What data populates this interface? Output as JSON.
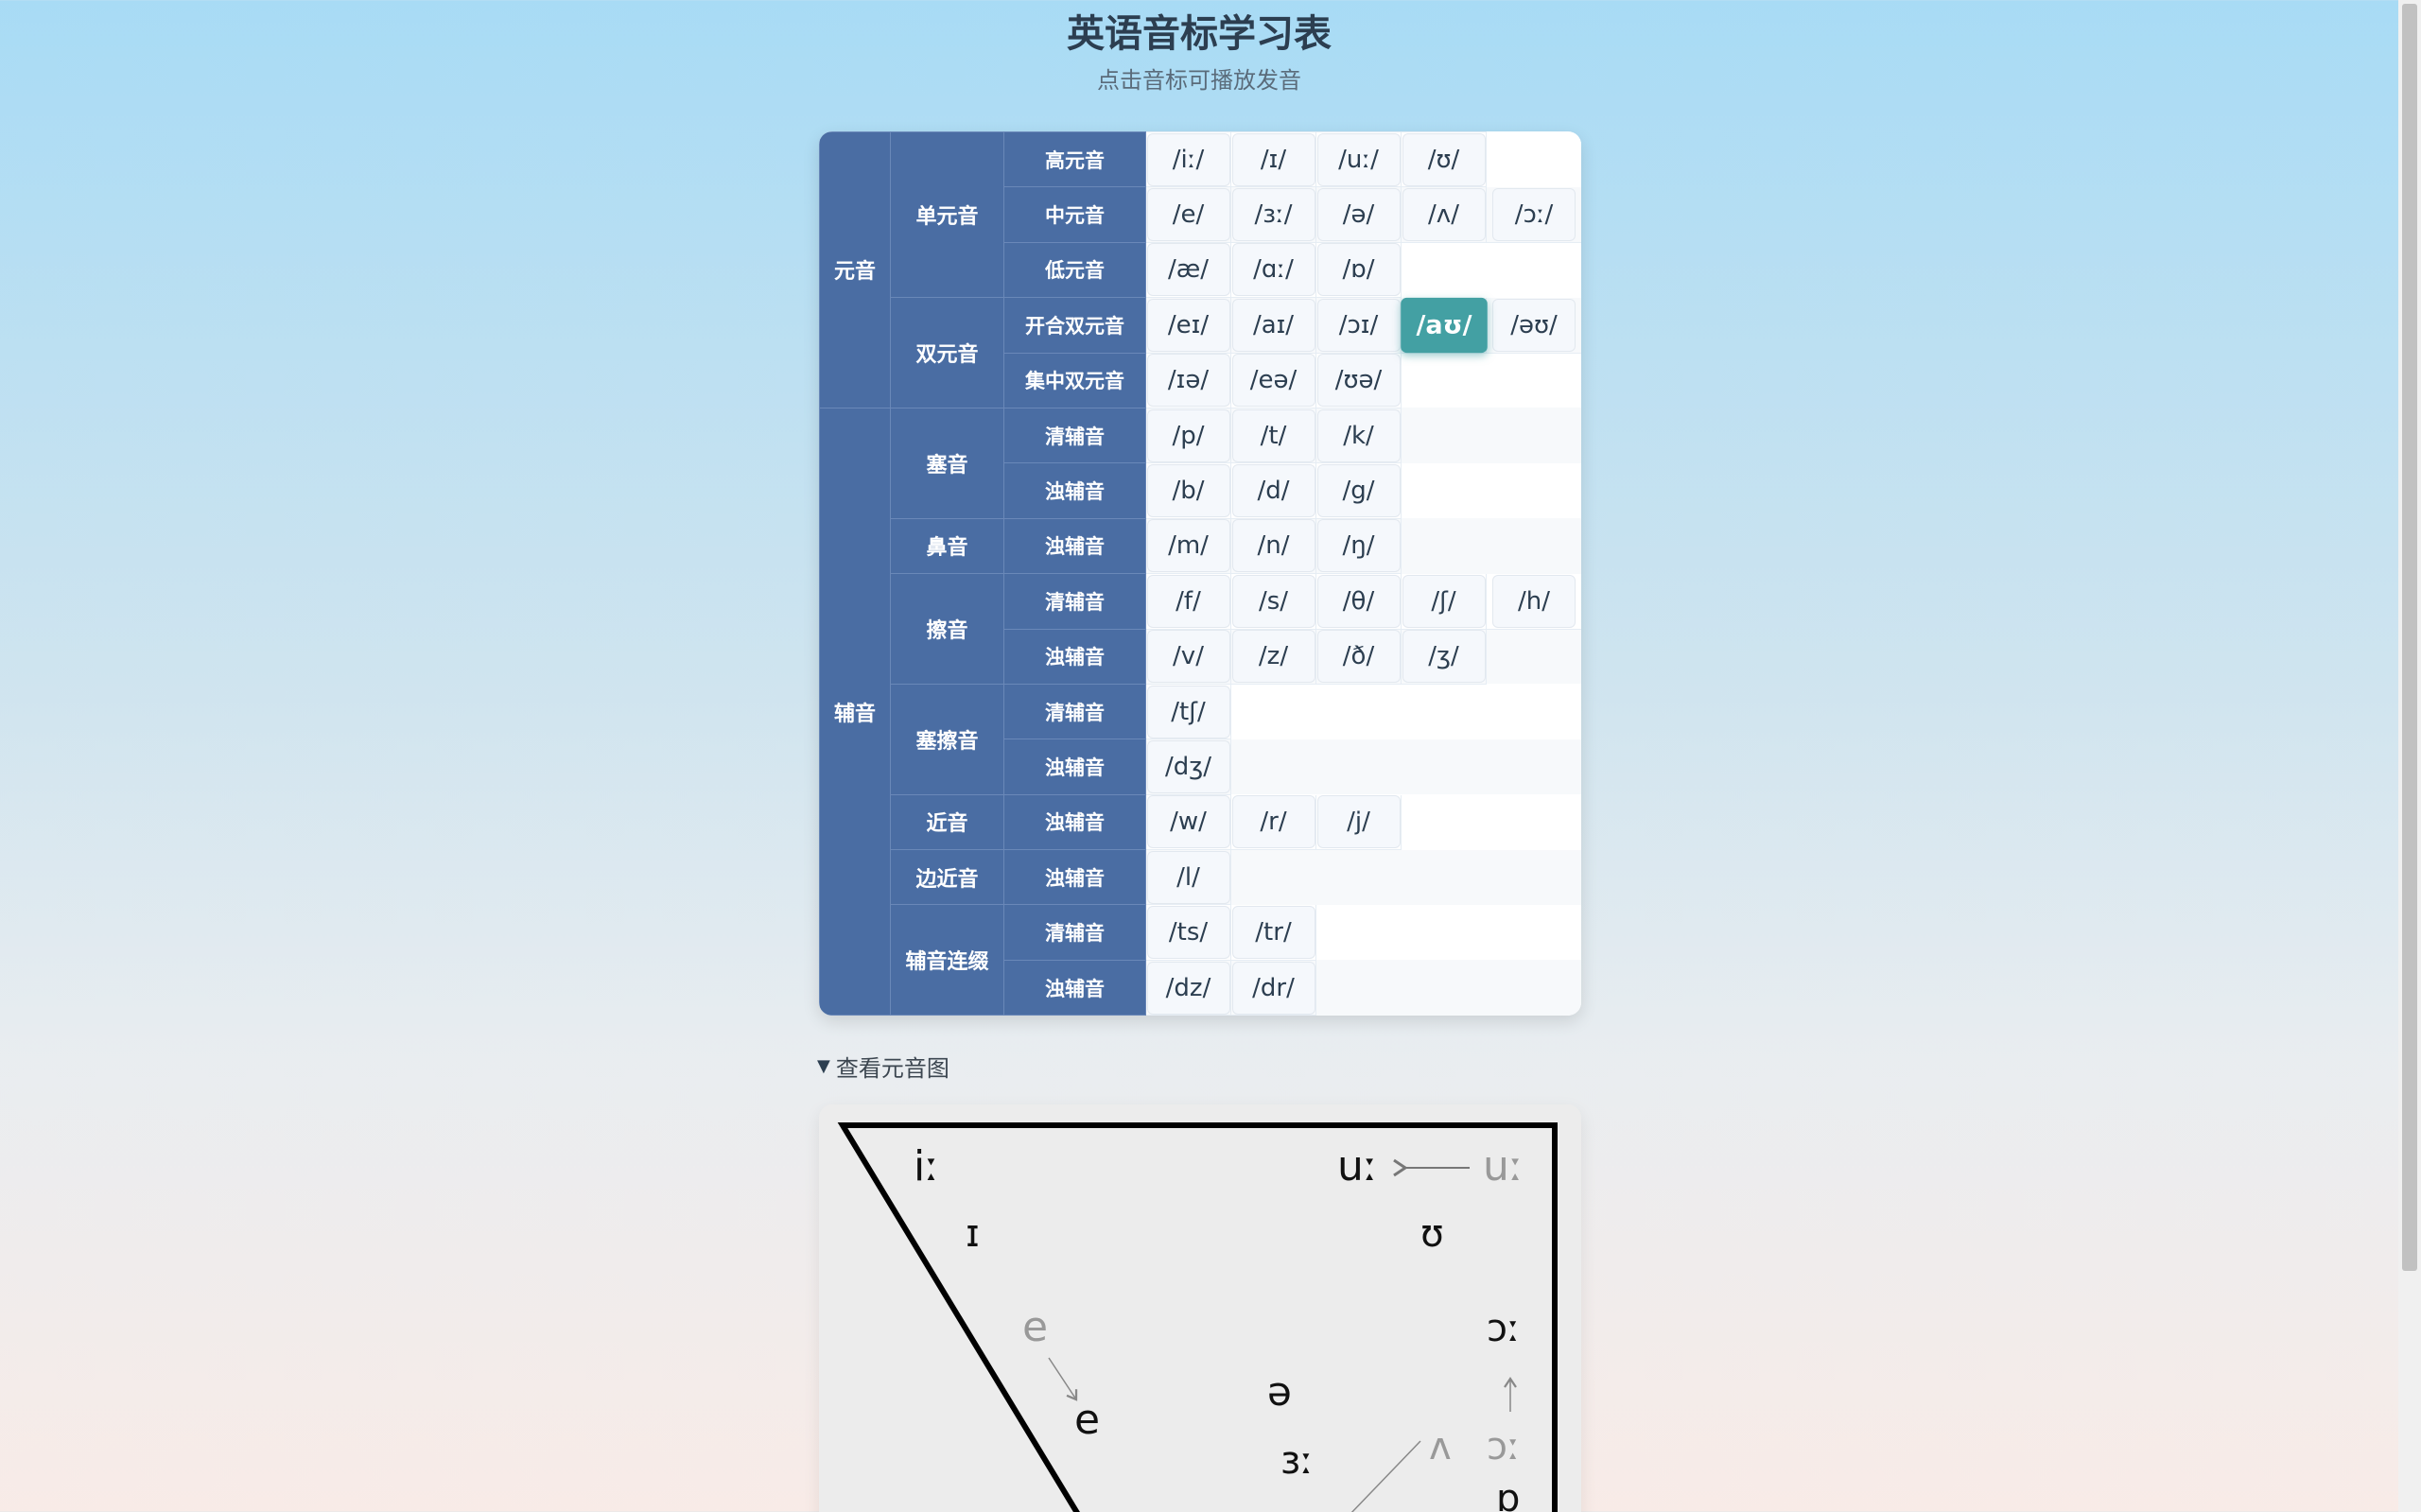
{
  "header": {
    "title": "英语音标学习表",
    "subtitle": "点击音标可播放发音"
  },
  "table": {
    "rows": [
      {
        "cat": "元音",
        "group": "单元音",
        "sub": "高元音",
        "symbols": [
          "/iː/",
          "/ɪ/",
          "/uː/",
          "/ʊ/"
        ]
      },
      {
        "cat": "",
        "group": "",
        "sub": "中元音",
        "symbols": [
          "/e/",
          "/ɜː/",
          "/ə/",
          "/ʌ/",
          "/ɔː/"
        ]
      },
      {
        "cat": "",
        "group": "",
        "sub": "低元音",
        "symbols": [
          "/æ/",
          "/ɑː/",
          "/ɒ/"
        ]
      },
      {
        "cat": "",
        "group": "双元音",
        "sub": "开合双元音",
        "symbols": [
          "/eɪ/",
          "/aɪ/",
          "/ɔɪ/",
          "/aʊ/",
          "/əʊ/"
        ],
        "active": 3
      },
      {
        "cat": "",
        "group": "",
        "sub": "集中双元音",
        "symbols": [
          "/ɪə/",
          "/eə/",
          "/ʊə/"
        ]
      },
      {
        "cat": "辅音",
        "group": "塞音",
        "sub": "清辅音",
        "symbols": [
          "/p/",
          "/t/",
          "/k/"
        ]
      },
      {
        "cat": "",
        "group": "",
        "sub": "浊辅音",
        "symbols": [
          "/b/",
          "/d/",
          "/g/"
        ]
      },
      {
        "cat": "",
        "group": "鼻音",
        "sub": "浊辅音",
        "symbols": [
          "/m/",
          "/n/",
          "/ŋ/"
        ]
      },
      {
        "cat": "",
        "group": "擦音",
        "sub": "清辅音",
        "symbols": [
          "/f/",
          "/s/",
          "/θ/",
          "/ʃ/",
          "/h/"
        ]
      },
      {
        "cat": "",
        "group": "",
        "sub": "浊辅音",
        "symbols": [
          "/v/",
          "/z/",
          "/ð/",
          "/ʒ/"
        ]
      },
      {
        "cat": "",
        "group": "塞擦音",
        "sub": "清辅音",
        "symbols": [
          "/tʃ/"
        ]
      },
      {
        "cat": "",
        "group": "",
        "sub": "浊辅音",
        "symbols": [
          "/dʒ/"
        ]
      },
      {
        "cat": "",
        "group": "近音",
        "sub": "浊辅音",
        "symbols": [
          "/w/",
          "/r/",
          "/j/"
        ]
      },
      {
        "cat": "",
        "group": "边近音",
        "sub": "浊辅音",
        "symbols": [
          "/l/"
        ]
      },
      {
        "cat": "",
        "group": "辅音连缀",
        "sub": "清辅音",
        "symbols": [
          "/ts/",
          "/tr/"
        ]
      },
      {
        "cat": "",
        "group": "",
        "sub": "浊辅音",
        "symbols": [
          "/dz/",
          "/dr/"
        ]
      }
    ]
  },
  "vowel_chart": {
    "toggle_label": "查看元音图",
    "labels": [
      "iː",
      "ɪ",
      "uː",
      "uː",
      "ʊ",
      "e",
      "e",
      "ɔː",
      "ə",
      "ɜː",
      "ʌ",
      "ɔː",
      "ɒ"
    ]
  },
  "colors": {
    "header_blue": "#4a6da3",
    "active_teal": "#43a0a3"
  }
}
